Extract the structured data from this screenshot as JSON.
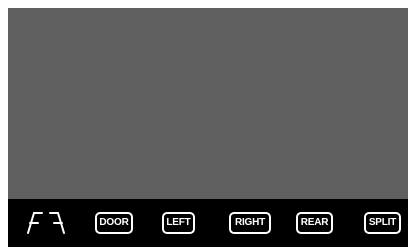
{
  "screen": {
    "background_color": "#5f5f5f"
  },
  "bottom_bar": {
    "background_color": "#000000",
    "guide_icon": "parking-guide-lines-icon",
    "buttons": [
      {
        "label": "DOOR"
      },
      {
        "label": "LEFT"
      },
      {
        "label": "RIGHT"
      },
      {
        "label": "REAR"
      },
      {
        "label": "SPLIT"
      }
    ]
  }
}
